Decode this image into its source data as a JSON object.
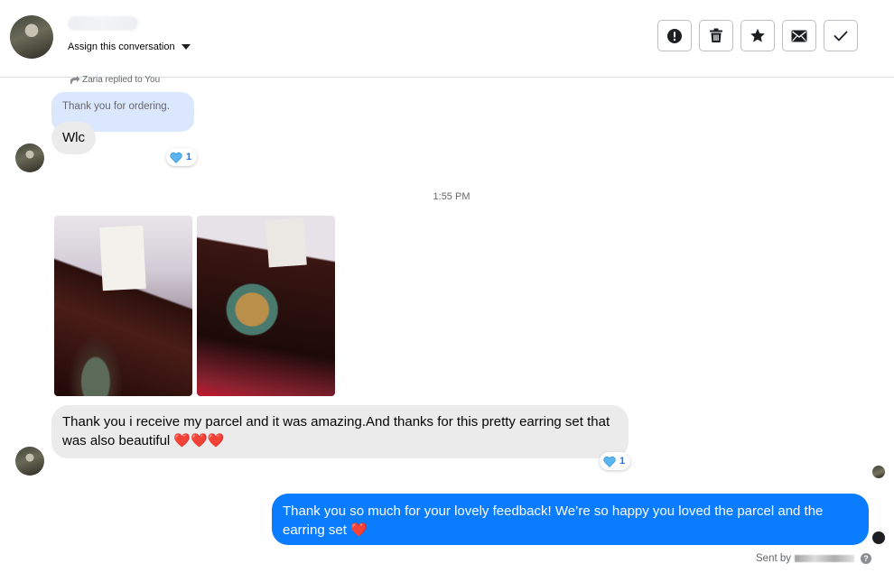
{
  "header": {
    "assign_label": "Assign this conversation",
    "actions": [
      {
        "name": "report-button",
        "icon": "exclamation-circle-icon"
      },
      {
        "name": "delete-button",
        "icon": "trash-icon"
      },
      {
        "name": "star-button",
        "icon": "star-icon"
      },
      {
        "name": "mark-unread-button",
        "icon": "envelope-icon"
      },
      {
        "name": "mark-done-button",
        "icon": "checkmark-icon"
      }
    ]
  },
  "thread": {
    "reply_note": "Zaria replied to You",
    "quoted_text": "Thank you for ordering.",
    "msg1": {
      "text": "Wlc",
      "reaction_count": "1",
      "reaction_icon": "blue-heart-icon"
    },
    "timestamp": "1:55 PM",
    "photos": [
      {
        "alt": "brown leather bag with tag"
      },
      {
        "alt": "brown leather bag with decorative panel"
      }
    ],
    "msg2": {
      "text": "Thank you i receive my parcel and it was amazing.And thanks for this pretty earring set that was also beautiful ❤️❤️❤️",
      "reaction_count": "1",
      "reaction_icon": "blue-heart-icon"
    },
    "msg3": {
      "text": "Thank you so much for your lovely feedback! We’re so happy you loved the parcel and the earring set ❤️"
    },
    "sent_by_label": "Sent by",
    "help_label": "?"
  },
  "colors": {
    "outgoing_bubble": "#0a7cff",
    "incoming_bubble": "#ebebeb",
    "quoted_bubble": "#dbe7fd",
    "reaction_count": "#1877f2"
  }
}
